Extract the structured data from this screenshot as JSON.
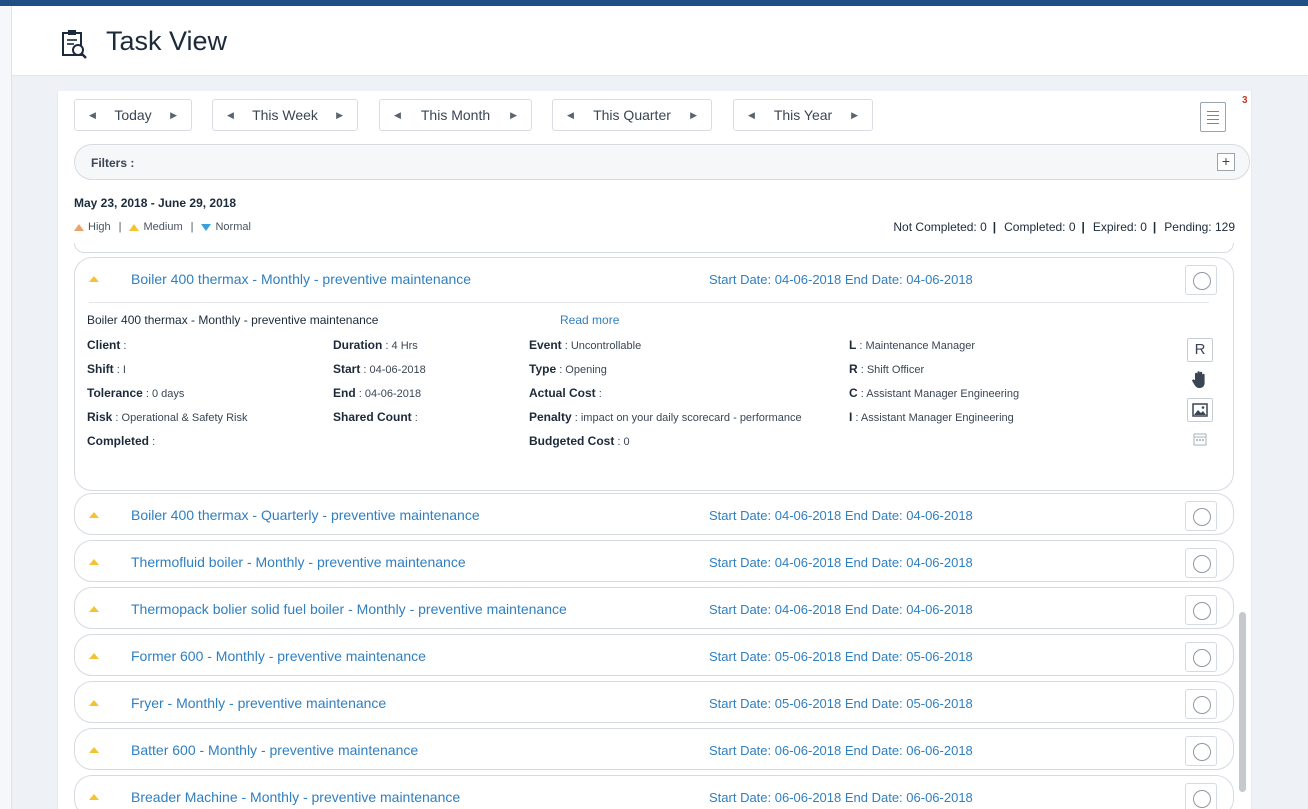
{
  "header": {
    "title": "Task View"
  },
  "periods": [
    {
      "label": "Today"
    },
    {
      "label": "This Week"
    },
    {
      "label": "This Month"
    },
    {
      "label": "This Quarter"
    },
    {
      "label": "This Year"
    }
  ],
  "notification_count": "3",
  "filters": {
    "label": "Filters :",
    "add_label": "+"
  },
  "date_range": "May 23, 2018 - June 29, 2018",
  "legend": {
    "high": "High",
    "medium": "Medium",
    "normal": "Normal",
    "sep": "|"
  },
  "stats": {
    "not_completed": "Not Completed: 0",
    "completed": "Completed: 0",
    "expired": "Expired: 0",
    "pending": "Pending: 129",
    "sep": "|"
  },
  "expanded": {
    "name": "Boiler 400 thermax - Monthly - preventive maintenance",
    "dates": "Start Date: 04-06-2018  End Date: 04-06-2018",
    "description": "Boiler 400 thermax - Monthly - preventive maintenance",
    "read_more": "Read more",
    "fields": {
      "client_label": "Client",
      "client_value": ":",
      "shift_label": "Shift",
      "shift_value": ": I",
      "tolerance_label": "Tolerance",
      "tolerance_value": ": 0 days",
      "risk_label": "Risk",
      "risk_value": ": Operational & Safety Risk",
      "completed_label": "Completed",
      "completed_value": ":",
      "duration_label": "Duration",
      "duration_value": ": 4 Hrs",
      "start_label": "Start",
      "start_value": ": 04-06-2018",
      "end_label": "End",
      "end_value": ": 04-06-2018",
      "shared_label": "Shared Count",
      "shared_value": ":",
      "event_label": "Event",
      "event_value": ": Uncontrollable",
      "type_label": "Type",
      "type_value": ": Opening",
      "actual_label": "Actual Cost",
      "actual_value": ":",
      "penalty_label": "Penalty",
      "penalty_value": ": impact on your daily scorecard - performance",
      "budget_label": "Budgeted Cost",
      "budget_value": ": 0",
      "l_label": "L",
      "l_value": ": Maintenance Manager",
      "r_label": "R",
      "r_value": ": Shift Officer",
      "c_label": "C",
      "c_value": ": Assistant Manager Engineering",
      "i_label": "I",
      "i_value": ": Assistant Manager Engineering"
    },
    "r_button": "R"
  },
  "tasks": [
    {
      "name": "Boiler 400 thermax - Quarterly - preventive maintenance",
      "dates": "Start Date: 04-06-2018  End Date: 04-06-2018"
    },
    {
      "name": "Thermofluid boiler - Monthly - preventive maintenance",
      "dates": "Start Date: 04-06-2018  End Date: 04-06-2018"
    },
    {
      "name": "Thermopack bolier solid fuel boiler - Monthly - preventive maintenance",
      "dates": "Start Date: 04-06-2018  End Date: 04-06-2018"
    },
    {
      "name": "Former 600 - Monthly - preventive maintenance",
      "dates": "Start Date: 05-06-2018  End Date: 05-06-2018"
    },
    {
      "name": "Fryer - Monthly - preventive maintenance",
      "dates": "Start Date: 05-06-2018  End Date: 05-06-2018"
    },
    {
      "name": "Batter 600 - Monthly - preventive maintenance",
      "dates": "Start Date: 06-06-2018  End Date: 06-06-2018"
    },
    {
      "name": "Breader Machine - Monthly - preventive maintenance",
      "dates": "Start Date: 06-06-2018  End Date: 06-06-2018"
    }
  ],
  "colors": {
    "link": "#2f7fc1",
    "medium": "#f2c433",
    "high": "#e6a36c",
    "normal": "#3aa0dc",
    "badge": "#c0392b"
  },
  "icons": [
    "clipboard-search-icon",
    "list-icon",
    "plus-icon",
    "check-circle-icon",
    "hand-icon",
    "image-icon",
    "calendar-icon"
  ]
}
